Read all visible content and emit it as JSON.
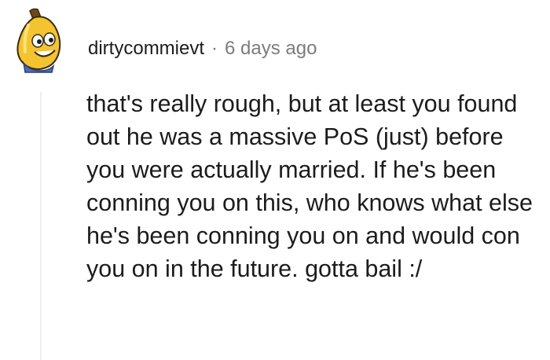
{
  "comment": {
    "username": "dirtycommievt",
    "separator": "·",
    "timestamp": "6 days ago",
    "text": "that's really rough, but at least you found out he was a massive PoS (just) before you were actually married. If he's been conning you on this, who knows what else he's been conning you on and would con you on in the future. gotta bail :/",
    "avatar_icon": "banana-mascot-icon"
  },
  "colors": {
    "text": "#1c1c1c",
    "meta": "#7c7c7c",
    "thread_line": "#edeff1",
    "avatar_yellow": "#f4c430"
  }
}
